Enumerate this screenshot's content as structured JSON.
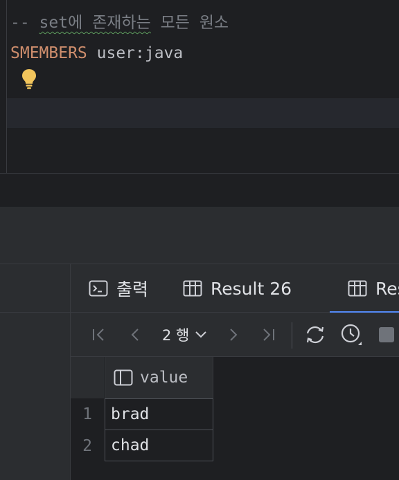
{
  "editor": {
    "comment_prefix": "-- ",
    "comment_text": "set에 존재하는",
    "comment_rest": " 모든 원소",
    "command_keyword": "SMEMBERS",
    "command_args": " user:java",
    "intention_icon": "lightbulb-icon"
  },
  "panel": {
    "tabs": [
      {
        "label": "출력",
        "icon": "console-icon"
      },
      {
        "label": "Result 26",
        "icon": "table-icon"
      },
      {
        "label": "Res",
        "icon": "table-icon",
        "active": true
      }
    ],
    "toolbar": {
      "rows_label": "2 행",
      "buttons": [
        "first-page-icon",
        "prev-page-icon",
        "next-page-icon",
        "last-page-icon",
        "refresh-icon",
        "history-icon",
        "stop-icon"
      ]
    },
    "grid": {
      "column": "value",
      "rows": [
        {
          "num": "1",
          "value": "brad"
        },
        {
          "num": "2",
          "value": "chad"
        }
      ]
    }
  },
  "colors": {
    "keyword": "#cf8e6d",
    "comment": "#7a7e85",
    "accent": "#548af7",
    "bulb": "#f2c55c"
  }
}
